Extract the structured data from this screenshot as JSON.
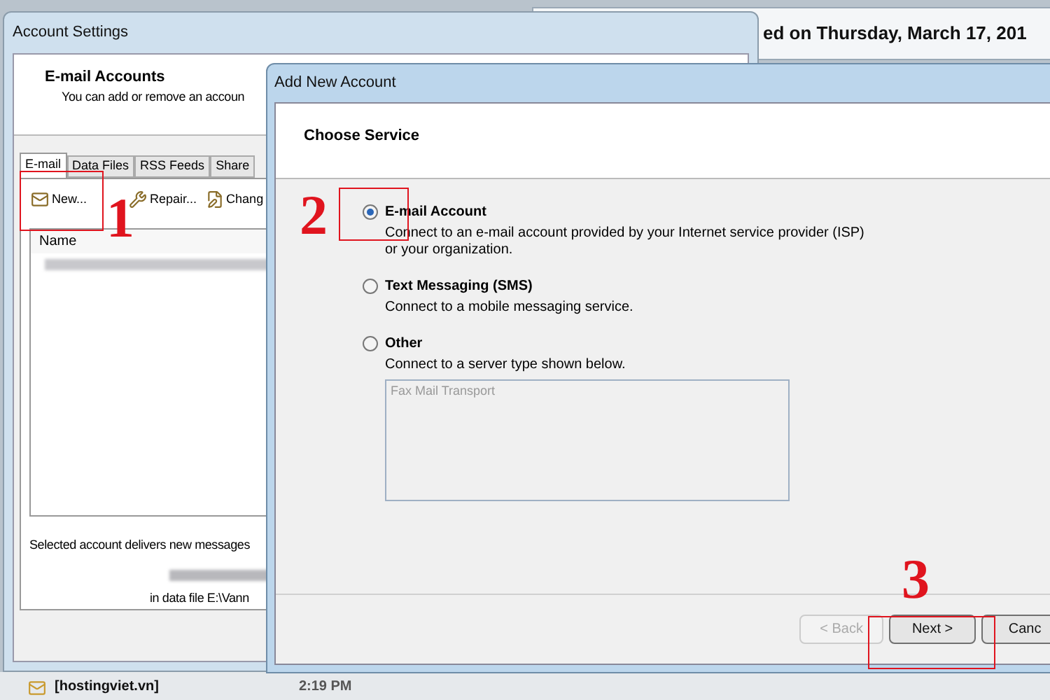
{
  "background_window": {
    "title_fragment": "ed on Thursday, March 17, 201"
  },
  "account_settings": {
    "title": "Account Settings",
    "section_title": "E-mail Accounts",
    "section_subtitle": "You can add or remove an accoun",
    "tabs": [
      {
        "label": "E-mail",
        "selected": true
      },
      {
        "label": "Data Files",
        "selected": false
      },
      {
        "label": "RSS Feeds",
        "selected": false
      },
      {
        "label": "Share",
        "selected": false
      }
    ],
    "toolbar": [
      {
        "label": "New...",
        "kind": "new"
      },
      {
        "label": "Repair...",
        "kind": "repair"
      },
      {
        "label": "Chang",
        "kind": "change"
      }
    ],
    "list": {
      "column": "Name"
    },
    "delivery_text": "Selected account delivers new messages",
    "data_file_text": "in data file E:\\Vann"
  },
  "dialog": {
    "title": "Add New Account",
    "heading": "Choose Service",
    "options": [
      {
        "label": "E-mail Account",
        "description": "Connect to an e-mail account provided by your Internet service provider (ISP) or your organization.",
        "selected": true
      },
      {
        "label": "Text Messaging (SMS)",
        "description": "Connect to a mobile messaging service.",
        "selected": false
      },
      {
        "label": "Other",
        "description": "Connect to a server type shown below.",
        "selected": false
      }
    ],
    "listbox": {
      "items": [
        "Fax Mail Transport"
      ]
    },
    "buttons": [
      {
        "label": "< Back",
        "disabled": true
      },
      {
        "label": "Next >",
        "disabled": false
      },
      {
        "label": "Canc",
        "disabled": false
      }
    ]
  },
  "taskbar": {
    "item": "[hostingviet.vn]",
    "time": "2:19 PM"
  },
  "annotations": [
    {
      "label": "1"
    },
    {
      "label": "2"
    },
    {
      "label": "3"
    }
  ]
}
